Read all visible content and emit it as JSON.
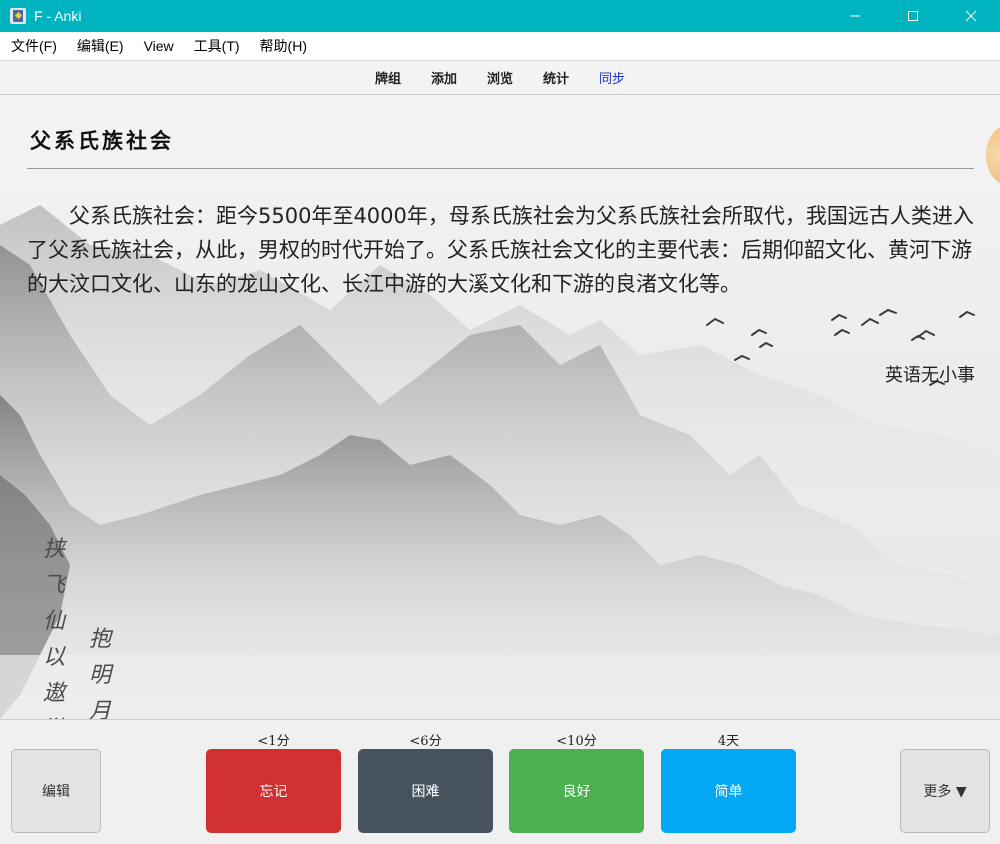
{
  "window": {
    "title": "F - Anki",
    "icons": {
      "app": "anki-icon",
      "minimize": "minimize-icon",
      "maximize": "maximize-icon",
      "close": "close-icon"
    }
  },
  "menubar": {
    "items": [
      {
        "label": "文件(F)"
      },
      {
        "label": "编辑(E)"
      },
      {
        "label": "View"
      },
      {
        "label": "工具(T)"
      },
      {
        "label": "帮助(H)"
      }
    ]
  },
  "toolbar": {
    "decks": "牌组",
    "add": "添加",
    "browse": "浏览",
    "stats": "统计",
    "sync": "同步",
    "sync_color": "#1a34c8"
  },
  "card": {
    "title": "父系氏族社会",
    "body": "父系氏族社会：距今5500年至4000年，母系氏族社会为父系氏族社会所取代，我国远古人类进入了父系氏族社会，从此，男权的时代开始了。父系氏族社会文化的主要代表：后期仰韶文化、黄河下游的大汶口文化、山东的龙山文化、长江中游的大溪文化和下游的良渚文化等。",
    "source": "英语无小事",
    "poem": {
      "right_column": "挟飞仙以遨游",
      "left_column": "抱明月"
    }
  },
  "answers": {
    "again": {
      "label": "忘记",
      "interval": "<1分",
      "color": "#d03030"
    },
    "hard": {
      "label": "困难",
      "interval": "<6分",
      "color": "#46535e"
    },
    "good": {
      "label": "良好",
      "interval": "<10分",
      "color": "#4caf50"
    },
    "easy": {
      "label": "简单",
      "interval": "4天",
      "color": "#03a9f4"
    }
  },
  "bottom": {
    "edit": "编辑",
    "more": "更多 ▼"
  }
}
